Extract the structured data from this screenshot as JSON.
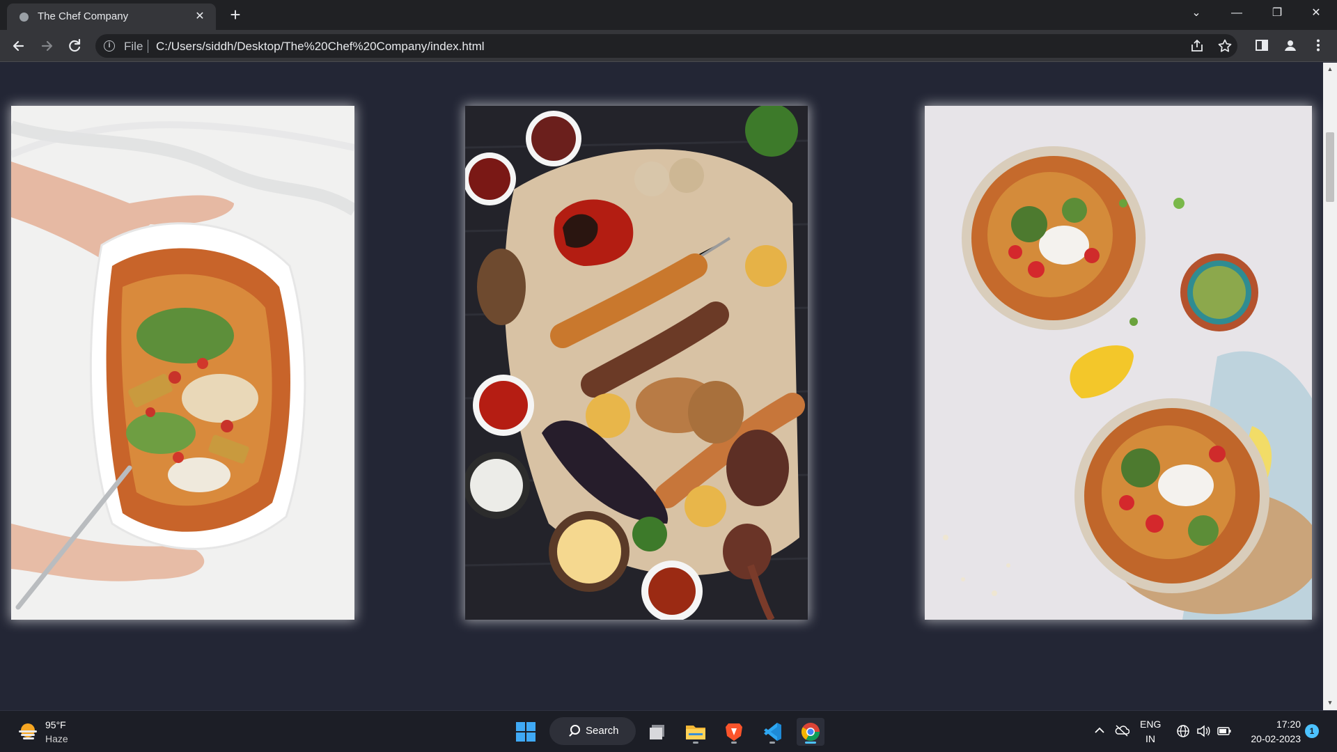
{
  "browser": {
    "tab_title": "The Chef Company",
    "tab_close": "✕",
    "new_tab": "+",
    "window_controls": {
      "tab_search": "⌄",
      "minimize": "—",
      "restore": "❐",
      "close": "✕"
    },
    "address_bar": {
      "scheme_label": "File",
      "url": "C:/Users/siddh/Desktop/The%20Chef%20Company/index.html"
    },
    "icons": {
      "back": "back-arrow-icon",
      "forward": "forward-arrow-icon",
      "reload": "reload-icon",
      "info": "info-icon",
      "share": "share-icon",
      "bookmark": "star-icon",
      "side_panel": "side-panel-icon",
      "profile": "profile-icon",
      "menu": "kebab-menu-icon"
    }
  },
  "page": {
    "background_color": "#232635",
    "gallery": [
      {
        "name": "Loaded sweet potato fries salad held in hands"
      },
      {
        "name": "Grilled meat skewers platter with sauces"
      },
      {
        "name": "Sweet potato fries bowls with guacamole and lemon"
      }
    ]
  },
  "taskbar": {
    "weather": {
      "temperature": "95°F",
      "condition": "Haze"
    },
    "search_label": "Search",
    "apps": [
      "start",
      "search",
      "task-view",
      "file-explorer",
      "brave",
      "vscode",
      "chrome"
    ],
    "tray": {
      "language_line1": "ENG",
      "language_line2": "IN",
      "time": "17:20",
      "date": "20-02-2023",
      "notification_count": "1"
    }
  }
}
